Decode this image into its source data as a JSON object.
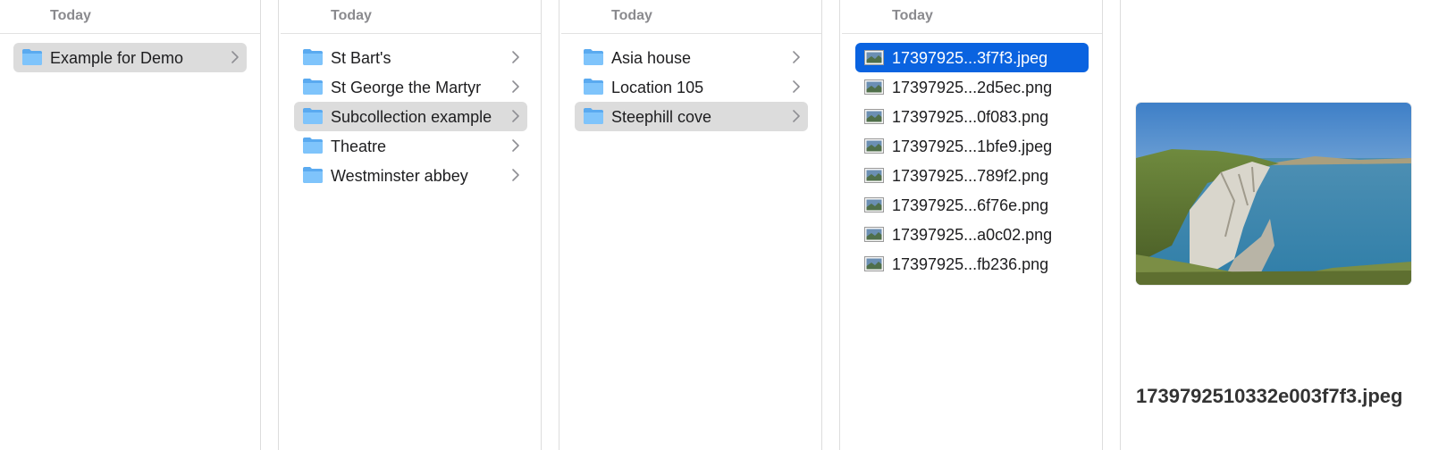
{
  "colors": {
    "selection": "#0a63e0",
    "highlight": "#dcdcdc",
    "folder": "#69b6f5",
    "header_text": "#8a8a8e"
  },
  "columns": [
    {
      "header": "Today",
      "items": [
        {
          "label": "Example for Demo",
          "icon": "folder-icon",
          "has_chevron": true,
          "state": "highlighted"
        }
      ]
    },
    {
      "header": "Today",
      "items": [
        {
          "label": "St Bart's",
          "icon": "folder-icon",
          "has_chevron": true,
          "state": "normal"
        },
        {
          "label": "St George the Martyr",
          "icon": "folder-icon",
          "has_chevron": true,
          "state": "normal"
        },
        {
          "label": "Subcollection example",
          "icon": "folder-icon",
          "has_chevron": true,
          "state": "highlighted"
        },
        {
          "label": "Theatre",
          "icon": "folder-icon",
          "has_chevron": true,
          "state": "normal"
        },
        {
          "label": "Westminster abbey",
          "icon": "folder-icon",
          "has_chevron": true,
          "state": "normal"
        }
      ]
    },
    {
      "header": "Today",
      "items": [
        {
          "label": "Asia house",
          "icon": "folder-icon",
          "has_chevron": true,
          "state": "normal"
        },
        {
          "label": "Location 105",
          "icon": "folder-icon",
          "has_chevron": true,
          "state": "normal"
        },
        {
          "label": "Steephill cove",
          "icon": "folder-icon",
          "has_chevron": true,
          "state": "highlighted"
        }
      ]
    },
    {
      "header": "Today",
      "items": [
        {
          "label": "17397925...3f7f3.jpeg",
          "icon": "image-file-icon",
          "has_chevron": false,
          "state": "selected"
        },
        {
          "label": "17397925...2d5ec.png",
          "icon": "image-file-icon",
          "has_chevron": false,
          "state": "normal"
        },
        {
          "label": "17397925...0f083.png",
          "icon": "image-file-icon",
          "has_chevron": false,
          "state": "normal"
        },
        {
          "label": "17397925...1bfe9.jpeg",
          "icon": "image-file-icon",
          "has_chevron": false,
          "state": "normal"
        },
        {
          "label": "17397925...789f2.png",
          "icon": "image-file-icon",
          "has_chevron": false,
          "state": "normal"
        },
        {
          "label": "17397925...6f76e.png",
          "icon": "image-file-icon",
          "has_chevron": false,
          "state": "normal"
        },
        {
          "label": "17397925...a0c02.png",
          "icon": "image-file-icon",
          "has_chevron": false,
          "state": "normal"
        },
        {
          "label": "17397925...fb236.png",
          "icon": "image-file-icon",
          "has_chevron": false,
          "state": "normal"
        }
      ]
    }
  ],
  "preview": {
    "image_icon": "coastal-cliff-photo",
    "filename": "1739792510332e003f7f3.jpeg"
  }
}
